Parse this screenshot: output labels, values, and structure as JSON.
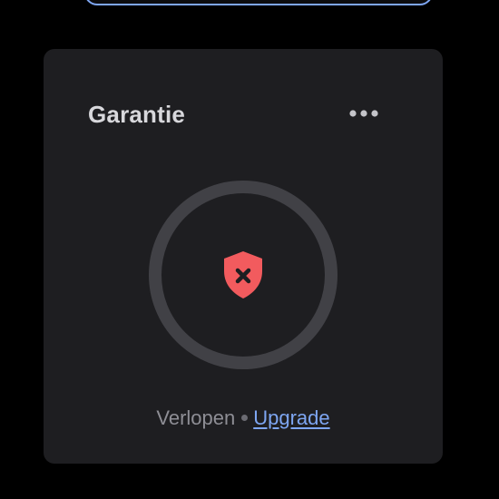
{
  "card": {
    "title": "Garantie",
    "menu_icon": "more-horizontal-icon",
    "status_icon": "shield-x-icon",
    "status_label": "Verlopen",
    "separator": "•",
    "action_label": "Upgrade"
  },
  "colors": {
    "background": "#000000",
    "card": "#1e1e21",
    "ring": "#414146",
    "shield": "#f25b5e",
    "link": "#7ea6f2",
    "title": "#d8d8dc",
    "muted": "#8e8e95"
  }
}
